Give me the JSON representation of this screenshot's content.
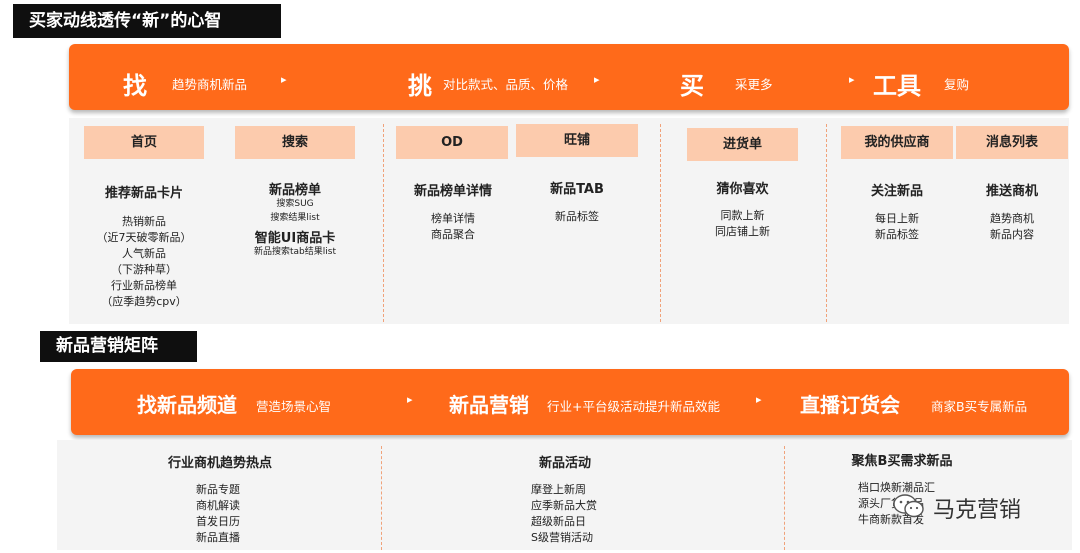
{
  "top": {
    "title": "买家动线透传“新”的心智",
    "banner": {
      "find": {
        "label": "找",
        "desc": "趋势商机新品"
      },
      "pick": {
        "label": "挑",
        "desc": "对比款式、品质、价格"
      },
      "buy": {
        "label": "买",
        "desc": "采更多"
      },
      "tools": {
        "label": "工具",
        "desc": "复购"
      }
    },
    "tabs": [
      "首页",
      "搜索",
      "OD",
      "旺铺",
      "进货单",
      "我的供应商",
      "消息列表"
    ],
    "columns": {
      "home": {
        "title": "推荐新品卡片",
        "items": [
          "热销新品",
          "（近7天破零新品）",
          "人气新品",
          "（下游种草）",
          "行业新品榜单",
          "（应季趋势cpv）"
        ]
      },
      "search": {
        "title": "新品榜单",
        "items": [
          "搜索SUG",
          "搜索结果list"
        ],
        "title2": "智能UI商品卡",
        "items2": [
          "新品搜索tab结果list"
        ]
      },
      "od": {
        "title": "新品榜单详情",
        "items": [
          "榜单详情",
          "商品聚合"
        ]
      },
      "shop": {
        "title": "新品TAB",
        "items": [
          "新品标签"
        ]
      },
      "cart": {
        "title": "猜你喜欢",
        "items": [
          "同款上新",
          "同店铺上新"
        ]
      },
      "supplier": {
        "title": "关注新品",
        "items": [
          "每日上新",
          "新品标签"
        ]
      },
      "message": {
        "title": "推送商机",
        "items": [
          "趋势商机",
          "新品内容"
        ]
      }
    }
  },
  "bottom": {
    "title": "新品营销矩阵",
    "banner": {
      "channel": {
        "label": "找新品频道",
        "desc": "营造场景心智"
      },
      "marketing": {
        "label": "新品营销",
        "desc": "行业+平台级活动提升新品效能"
      },
      "live": {
        "label": "直播订货会",
        "desc": "商家B买专属新品"
      }
    },
    "columns": {
      "trend": {
        "title": "行业商机趋势热点",
        "items": [
          "新品专题",
          "商机解读",
          "首发日历",
          "新品直播"
        ]
      },
      "activity": {
        "title": "新品活动",
        "items": [
          "摩登上新周",
          "应季新品大赏",
          "超级新品日",
          "S级营销活动"
        ]
      },
      "focus": {
        "title": "聚焦B买需求新品",
        "items": [
          "档口焕新潮品汇",
          "源头厂货爆品",
          "牛商新款首发"
        ]
      }
    },
    "watermark": "马克营销"
  },
  "arrow_glyph": "▸",
  "colors": {
    "accent": "#ff6a1a",
    "tab": "#fccbad",
    "tag_bg": "#0f0f0f",
    "panel": "#f4f4f4"
  }
}
